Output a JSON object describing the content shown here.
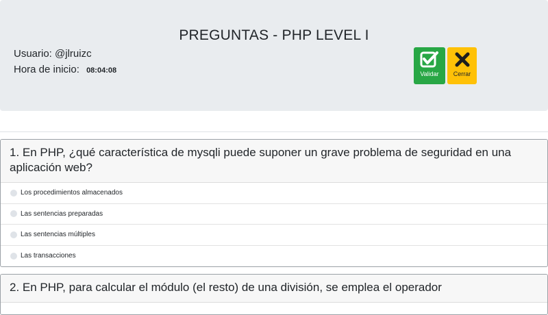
{
  "header": {
    "title": "PREGUNTAS - PHP LEVEL I",
    "user_label": "Usuario:",
    "user_value": "@jlruizc",
    "time_label": "Hora de inicio:",
    "time_value": "08:04:08",
    "validate_label": "Validar",
    "close_label": "Cerrar"
  },
  "questions": [
    {
      "text": "1. En PHP, ¿qué característica de mysqli puede suponer un grave problema de seguridad en una aplicación web?",
      "options": [
        "Los procedimientos almacenados",
        "Las sentencias preparadas",
        "Las sentencias múltiples",
        "Las transacciones"
      ]
    },
    {
      "text": "2. En PHP, para calcular el módulo (el resto) de una división, se emplea el operador"
    }
  ],
  "colors": {
    "validate": "#28a745",
    "close": "#ffc107",
    "header_bg": "#e9ecef"
  },
  "icons": {
    "validate": "checkbox-check-icon",
    "close": "x-icon"
  }
}
